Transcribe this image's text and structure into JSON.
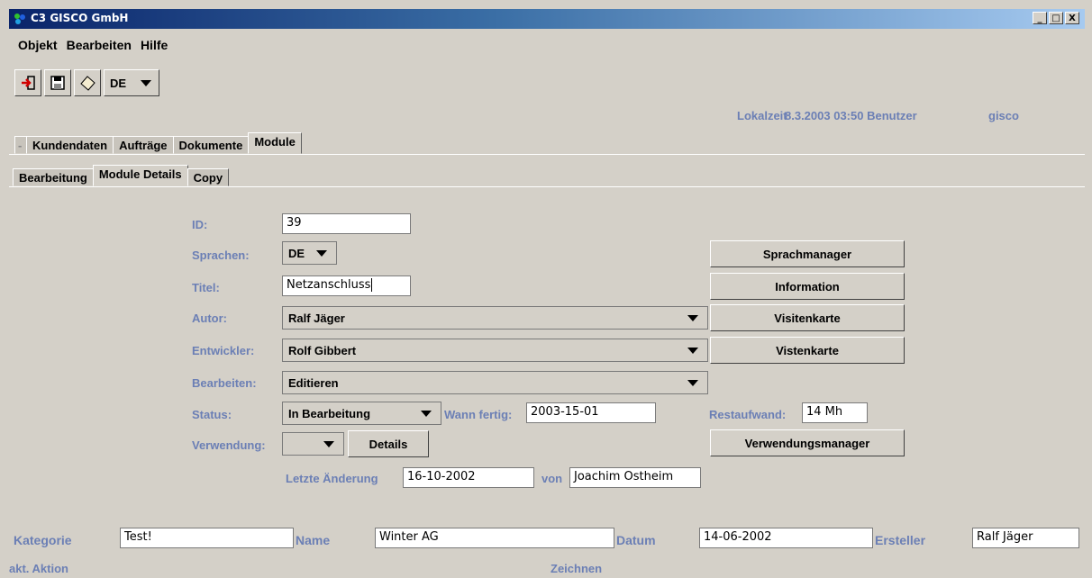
{
  "window": {
    "title": "C3 GISCO GmbH",
    "controls": [
      "_",
      "□",
      "X"
    ]
  },
  "menu": [
    "Objekt",
    "Bearbeiten",
    "Hilfe"
  ],
  "toolbar": {
    "icons": [
      "exit-icon",
      "save-icon",
      "erase-icon"
    ],
    "language": "DE"
  },
  "header": {
    "lokalzeit_label": "Lokalzeit",
    "datetime_user": "8.3.2003 03:50 Benutzer",
    "user": "gisco"
  },
  "main_tabs": {
    "dash": "-",
    "items": [
      "Kundendaten",
      "Aufträge",
      "Dokumente",
      "Module"
    ],
    "active": "Module"
  },
  "sub_tabs": {
    "items": [
      "Bearbeitung",
      "Module Details",
      "Copy"
    ],
    "active": "Module Details"
  },
  "form": {
    "id_label": "ID:",
    "id_value": "39",
    "sprachen_label": "Sprachen:",
    "sprachen_value": "DE",
    "titel_label": "Titel:",
    "titel_value": "Netzanschluss",
    "autor_label": "Autor:",
    "autor_value": "Ralf Jäger",
    "entwickler_label": "Entwickler:",
    "entwickler_value": "Rolf Gibbert",
    "bearbeiten_label": "Bearbeiten:",
    "bearbeiten_value": "Editieren",
    "status_label": "Status:",
    "status_value": "In Bearbeitung",
    "wann_fertig_label": "Wann fertig:",
    "wann_fertig_value": "2003-15-01",
    "restaufwand_label": "Restaufwand:",
    "restaufwand_value": "14 Mh",
    "verwendung_label": "Verwendung:",
    "details_button": "Details",
    "letzte_aenderung_label": "Letzte Änderung",
    "letzte_aenderung_value": "16-10-2002",
    "von_label": "von",
    "von_value": "Joachim Ostheim"
  },
  "side_buttons": {
    "sprachmanager": "Sprachmanager",
    "information": "Information",
    "visitenkarte": "Visitenkarte",
    "vistenkarte": "Vistenkarte",
    "verwendungsmanager": "Verwendungsmanager"
  },
  "bottom": {
    "kategorie_label": "Kategorie",
    "kategorie_value": "Test!",
    "name_label": "Name",
    "name_value": "Winter AG",
    "datum_label": "Datum",
    "datum_value": "14-06-2002",
    "ersteller_label": "Ersteller",
    "ersteller_value": "Ralf Jäger"
  },
  "statusbar": {
    "aktion_label": "akt. Aktion",
    "aktion_value": "Zeichnen"
  }
}
